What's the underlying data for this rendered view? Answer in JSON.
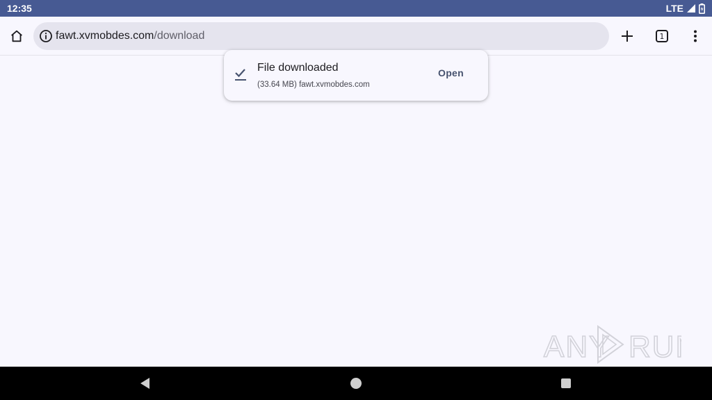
{
  "status_bar": {
    "time": "12:35",
    "network": "LTE",
    "icons": [
      "signal-icon",
      "battery-icon"
    ]
  },
  "toolbar": {
    "url_host": "fawt.xvmobdes.com",
    "url_path": "/download",
    "tab_count": "1",
    "icons": [
      "home-icon",
      "info-icon",
      "plus-icon",
      "tab-switcher-icon",
      "more-vert-icon"
    ]
  },
  "download": {
    "title": "File downloaded",
    "details": "(33.64 MB) fawt.xvmobdes.com",
    "action_label": "Open",
    "icon": "check-icon"
  },
  "watermark": {
    "brand": "ANY RUN"
  },
  "nav_bar": {
    "icons": [
      "back-icon",
      "home-circle-icon",
      "recents-icon"
    ]
  },
  "colors": {
    "status_bar_bg": "#475a93",
    "page_bg": "#f8f7fe",
    "omnibox_bg": "#e5e4ee",
    "action_text": "#47536f",
    "nav_bar_bg": "#000000"
  }
}
